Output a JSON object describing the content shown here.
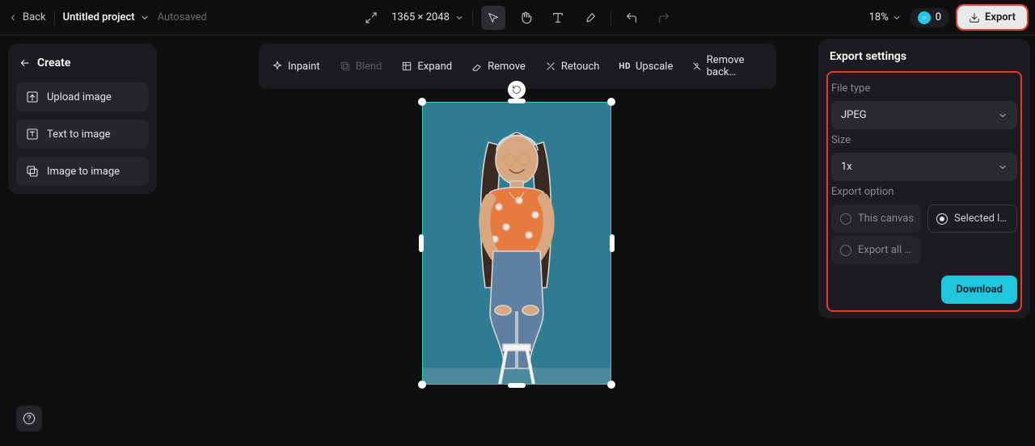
{
  "topbar": {
    "back": "Back",
    "project_name": "Untitled project",
    "autosaved": "Autosaved",
    "dimensions": "1365 × 2048",
    "zoom": "18%",
    "credits": "0",
    "export": "Export"
  },
  "sidebar": {
    "create": "Create",
    "upload": "Upload image",
    "text2img": "Text to image",
    "img2img": "Image to image"
  },
  "tools": {
    "inpaint": "Inpaint",
    "blend": "Blend",
    "expand": "Expand",
    "remove": "Remove",
    "retouch": "Retouch",
    "upscale": "Upscale",
    "removebg": "Remove back…"
  },
  "panel": {
    "title": "Export settings",
    "filetype_label": "File type",
    "filetype_value": "JPEG",
    "size_label": "Size",
    "size_value": "1x",
    "option_label": "Export option",
    "opt_canvas": "This canvas",
    "opt_selected": "Selected l…",
    "opt_all": "Export all …",
    "download": "Download"
  }
}
